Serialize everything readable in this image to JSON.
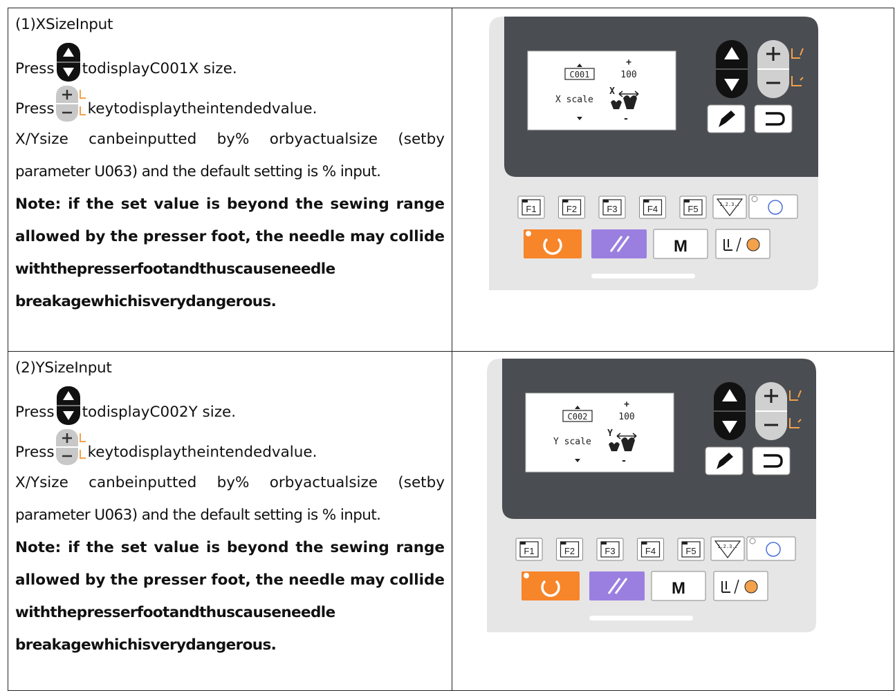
{
  "sections": [
    {
      "heading": "(1)XSizeInput",
      "step1_prefix": "Press",
      "step1_suffix": "todisplayC001X size.",
      "step2_prefix": "Press",
      "step2_suffix": "keytodisplaytheintendedvalue.",
      "para_words": [
        "X/Ysize",
        "canbeinputted",
        "by%",
        "orbyactualsize",
        "(setby"
      ],
      "para_line2": "parameter U063) and the default setting is % input.",
      "note_line1_words": [
        "Note:",
        "if",
        "the",
        "set",
        "value",
        "is",
        "beyond",
        "the",
        "sewing",
        "range"
      ],
      "note_line2_words": [
        "allowed",
        "by",
        "the",
        "presser",
        "foot,",
        "the",
        "needle",
        "may",
        "collide"
      ],
      "note_line3": "withthepresserfootandthuscauseneedle",
      "note_line4": "breakagewhichisverydangerous.",
      "panel": {
        "code": "C001",
        "scale_label": "X scale",
        "value": "100",
        "axis_letter": "X",
        "plus": "+",
        "minus": "-",
        "fkeys": [
          "F1",
          "F2",
          "F3",
          "F4",
          "F5"
        ],
        "counter_label": "1.2.3..",
        "m_label": "M"
      }
    },
    {
      "heading": "(2)YSizeInput",
      "step1_prefix": "Press",
      "step1_suffix": "todisplayC002Y size.",
      "step2_prefix": "Press",
      "step2_suffix": "keytodisplaytheintendedvalue.",
      "para_words": [
        "X/Ysize",
        "canbeinputted",
        "by%",
        "orbyactualsize",
        "(setby"
      ],
      "para_line2": "parameter U063) and the default setting is % input.",
      "note_line1_words": [
        "Note:",
        "if",
        "the",
        "set",
        "value",
        "is",
        "beyond",
        "the",
        "sewing",
        "range"
      ],
      "note_line2_words": [
        "allowed",
        "by",
        "the",
        "presser",
        "foot,",
        "the",
        "needle",
        "may",
        "collide"
      ],
      "note_line3": "withthepresserfootandthuscauseneedle",
      "note_line4": "breakagewhichisverydangerous.",
      "panel": {
        "code": "C002",
        "scale_label": "Y scale",
        "value": "100",
        "axis_letter": "Y",
        "plus": "+",
        "minus": "-",
        "fkeys": [
          "F1",
          "F2",
          "F3",
          "F4",
          "F5"
        ],
        "counter_label": "1.2.3..",
        "m_label": "M"
      }
    }
  ],
  "colors": {
    "panel_dark": "#4a4d52",
    "panel_light": "#e6e6e6",
    "key_dark": "#111111",
    "reset_orange": "#f7852a",
    "clear_purple": "#9b7fe0",
    "accent_orange": "#f3a14a"
  }
}
